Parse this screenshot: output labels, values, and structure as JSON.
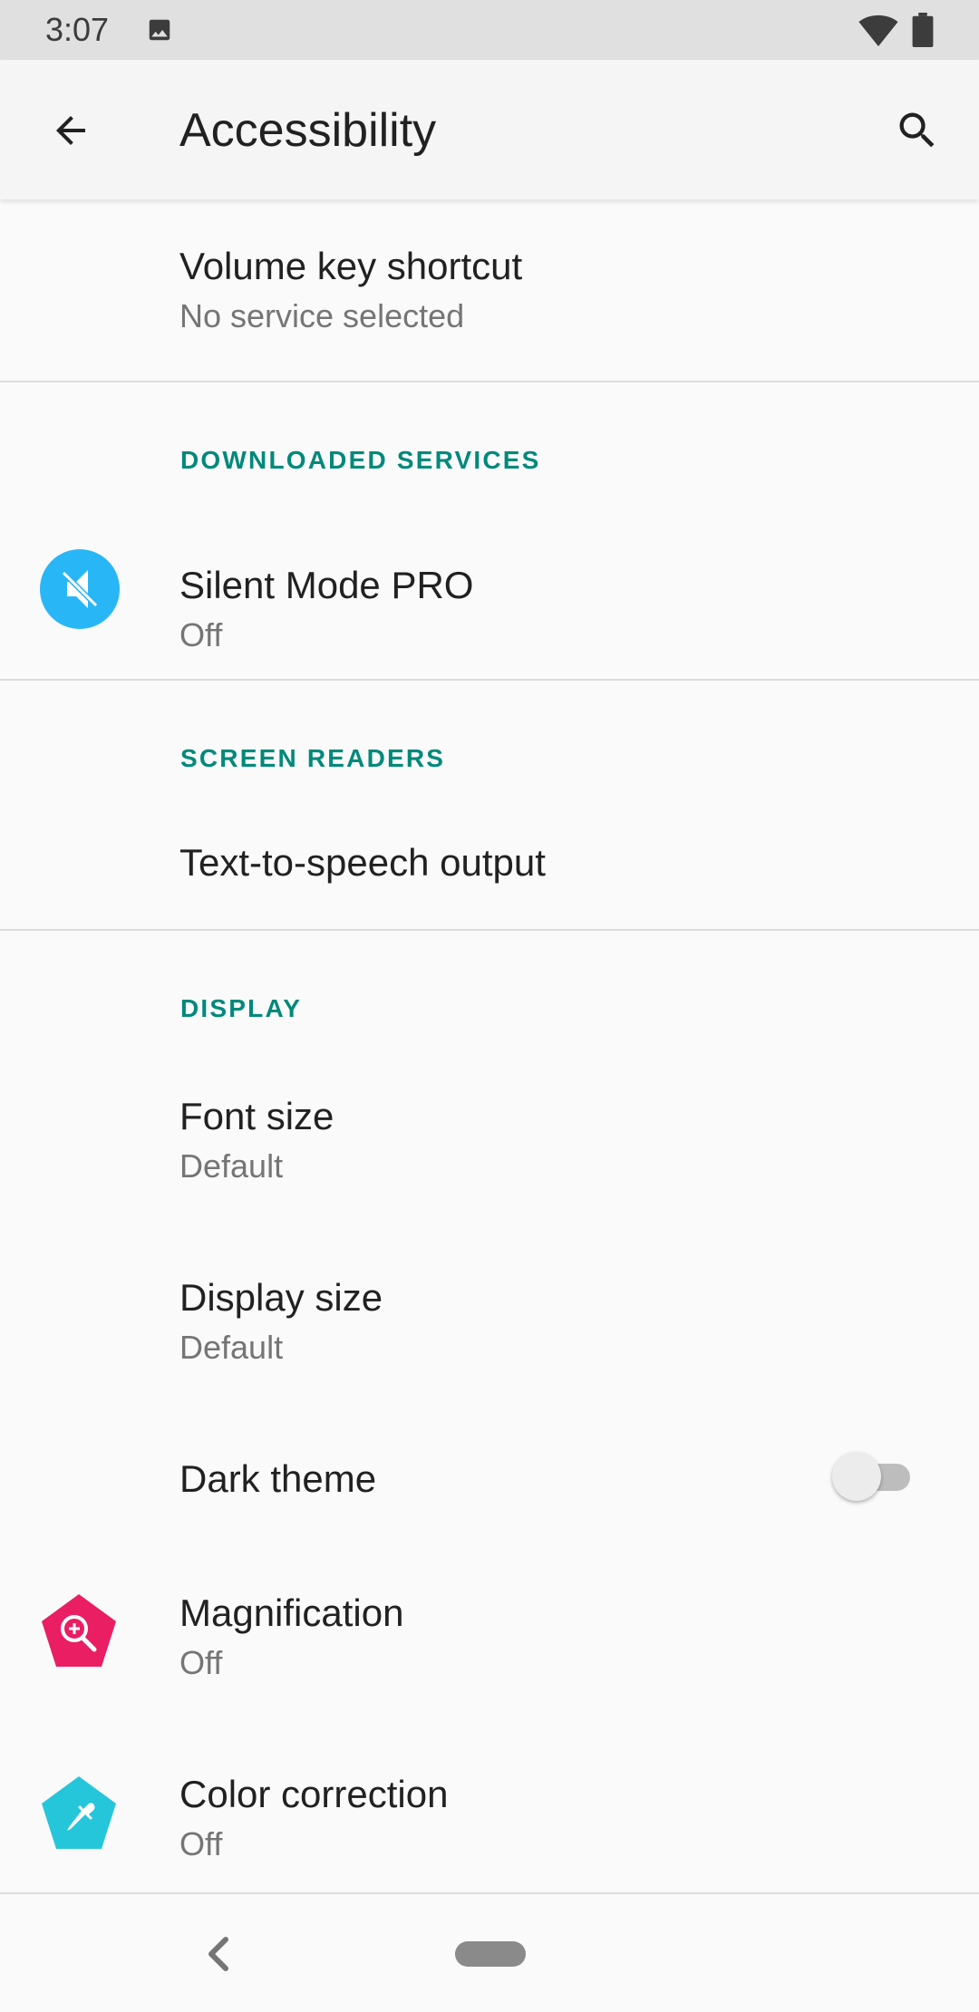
{
  "status_bar": {
    "time": "3:07",
    "icons": [
      "image-icon",
      "wifi-icon",
      "battery-icon"
    ]
  },
  "app_bar": {
    "title": "Accessibility",
    "back_icon": "arrow-back-icon",
    "search_icon": "search-icon"
  },
  "list": {
    "volume_key": {
      "title": "Volume key shortcut",
      "subtitle": "No service selected"
    },
    "downloaded_services_header": "DOWNLOADED SERVICES",
    "silent_mode": {
      "title": "Silent Mode PRO",
      "subtitle": "Off",
      "icon": "volume-off-icon"
    },
    "screen_readers_header": "SCREEN READERS",
    "tts": {
      "title": "Text-to-speech output"
    },
    "display_header": "DISPLAY",
    "font_size": {
      "title": "Font size",
      "subtitle": "Default"
    },
    "display_size": {
      "title": "Display size",
      "subtitle": "Default"
    },
    "dark_theme": {
      "title": "Dark theme",
      "enabled": false
    },
    "magnification": {
      "title": "Magnification",
      "subtitle": "Off",
      "icon": "magnification-icon"
    },
    "color_correction": {
      "title": "Color correction",
      "subtitle": "Off",
      "icon": "color-correction-icon"
    }
  },
  "nav_bar": {
    "back_icon": "nav-back-icon",
    "home_icon": "nav-home-pill"
  },
  "colors": {
    "accent": "#00897b",
    "silent_mode_icon_bg": "#29b6f6",
    "magnification_icon_bg": "#e91e63",
    "color_correction_icon_bg": "#26c6da"
  }
}
